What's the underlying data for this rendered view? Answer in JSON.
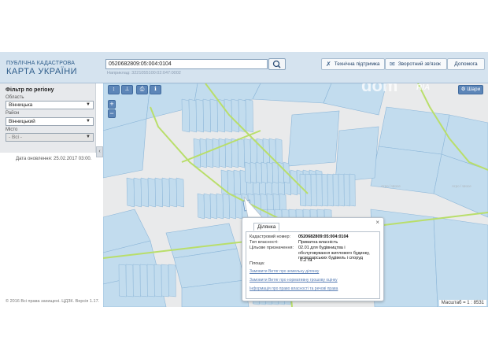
{
  "header": {
    "logo_line1": "ПУБЛІЧНА КАДАСТРОВА",
    "logo_line2": "КАРТА УКРАЇНИ",
    "search_value": "0520682809:05:004:0104",
    "search_hint": "Наприклад: 3221055100:02:047:0002",
    "buttons": {
      "support": "Технічна підтримка",
      "feedback": "Зворотний зв'язок",
      "help": "Допомога"
    }
  },
  "sidebar": {
    "filter_title": "Фільтр по регіону",
    "oblast_label": "Область",
    "oblast_value": "Вінницька",
    "rayon_label": "Район",
    "rayon_value": "Вінницький",
    "city_label": "Місто",
    "city_value": "- Всі -",
    "update_date": "Дата оновлення: 25.02.2017 03:00.",
    "copyright": "© 2016 Всі права захищені. ЦДЗК. Версія 1.17."
  },
  "map": {
    "layers_label": "Шари",
    "scale_label": "Масштаб = 1 : 8531",
    "watermark_dom": "dom",
    "watermark_ria": "RIA",
    "colors": {
      "parcel_fill": "#c2dcee",
      "parcel_stroke": "#8cb6d8",
      "road": "#b9de6a",
      "background": "#e9eaeb"
    }
  },
  "popup": {
    "tab_label": "Ділянка",
    "rows": [
      {
        "label": "Кадастровий номер:",
        "value": "0520682809:05:004:0104"
      },
      {
        "label": "Тип власності:",
        "value": "Приватна власність"
      },
      {
        "label": "Цільове призначення:",
        "value": "02.01 для будівництва і обслуговування житлового будинку, господарських будівель і споруд"
      },
      {
        "label": "Площа:",
        "value": "0.2 га"
      }
    ],
    "links": [
      "Замовити Витяг про земельну ділянку",
      "Замовити Витяг про нормативну грошову оцінку",
      "Інформація про право власності та речові права"
    ]
  }
}
